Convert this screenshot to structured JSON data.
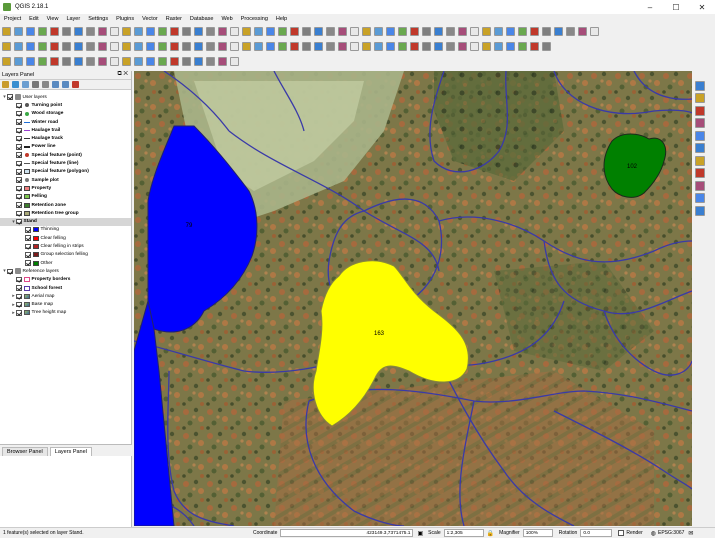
{
  "window": {
    "title": "QGIS 2.18.1",
    "controls": [
      "–",
      "☐",
      "✕"
    ]
  },
  "menu": [
    "Project",
    "Edit",
    "View",
    "Layer",
    "Settings",
    "Plugins",
    "Vector",
    "Raster",
    "Database",
    "Web",
    "Processing",
    "Help"
  ],
  "layers_panel": {
    "title": "Layers Panel",
    "tree": [
      {
        "label": "User layers",
        "level": 0,
        "bold": false,
        "expanded": true,
        "group": true
      },
      {
        "label": "Turning point",
        "level": 1,
        "bold": true,
        "symbol": "#555555",
        "shape": "dot"
      },
      {
        "label": "Wood storage",
        "level": 1,
        "bold": true,
        "symbol": "#3aa845",
        "shape": "dot"
      },
      {
        "label": "Winter road",
        "level": 1,
        "bold": true,
        "symbol": "#1e6fd8",
        "shape": "dash"
      },
      {
        "label": "Haulage trail",
        "level": 1,
        "bold": true,
        "symbol": "#9a3fd0",
        "shape": "line"
      },
      {
        "label": "Haulage track",
        "level": 1,
        "bold": true,
        "symbol": "#333333",
        "shape": "dash"
      },
      {
        "label": "Power line",
        "level": 1,
        "bold": true,
        "symbol": "#222222",
        "shape": "line"
      },
      {
        "label": "Special feature (point)",
        "level": 1,
        "bold": true,
        "symbol": "#c0392b",
        "shape": "dot"
      },
      {
        "label": "Special feature (line)",
        "level": 1,
        "bold": true,
        "symbol": "#555555",
        "shape": "line"
      },
      {
        "label": "Special feature (polygon)",
        "level": 1,
        "bold": true,
        "symbol": "#cfe3f0",
        "shape": "box"
      },
      {
        "label": "Sample plot",
        "level": 1,
        "bold": true,
        "symbol": "#777777",
        "shape": "dot"
      },
      {
        "label": "Property",
        "level": 1,
        "bold": true,
        "symbol": "#f08080",
        "shape": "box"
      },
      {
        "label": "Felling",
        "level": 1,
        "bold": true,
        "symbol": "#7ec850",
        "shape": "box"
      },
      {
        "label": "Retention zone",
        "level": 1,
        "bold": true,
        "symbol": "#3c7d2e",
        "shape": "box"
      },
      {
        "label": "Retention tree group",
        "level": 1,
        "bold": true,
        "symbol": "#a8a878",
        "shape": "box"
      },
      {
        "label": "Stand",
        "level": 1,
        "bold": true,
        "symbol": "",
        "shape": "none",
        "expanded": true,
        "selected": true
      },
      {
        "label": "Thinning",
        "level": 2,
        "bold": false,
        "symbol": "#0000ff",
        "shape": "box"
      },
      {
        "label": "Clear felling",
        "level": 2,
        "bold": false,
        "symbol": "#ff0000",
        "shape": "box"
      },
      {
        "label": "Clear felling in strips",
        "level": 2,
        "bold": false,
        "symbol": "#b22222",
        "shape": "box"
      },
      {
        "label": "Group selection felling",
        "level": 2,
        "bold": false,
        "symbol": "#7a1a1a",
        "shape": "box"
      },
      {
        "label": "Other",
        "level": 2,
        "bold": false,
        "symbol": "#008000",
        "shape": "box"
      },
      {
        "label": "Reference layers",
        "level": 0,
        "bold": false,
        "expanded": true,
        "group": true
      },
      {
        "label": "Property borders",
        "level": 1,
        "bold": true,
        "symbol": "#ffffff",
        "shape": "outline-pink"
      },
      {
        "label": "School forest",
        "level": 1,
        "bold": true,
        "symbol": "#ffffff",
        "shape": "outline-purple"
      },
      {
        "label": "Aerial map",
        "level": 1,
        "bold": false,
        "symbol": "",
        "shape": "raster",
        "collapsed": true
      },
      {
        "label": "Base map",
        "level": 1,
        "bold": false,
        "symbol": "",
        "shape": "raster",
        "collapsed": true
      },
      {
        "label": "Tree height map",
        "level": 1,
        "bold": false,
        "symbol": "",
        "shape": "raster",
        "collapsed": true
      }
    ],
    "tabs": [
      "Browser Panel",
      "Layers Panel"
    ]
  },
  "map": {
    "labels": [
      "79",
      "163",
      "102"
    ],
    "colors": {
      "thinning": "#0000ff",
      "other": "#008000",
      "highlight": "#ffff00",
      "boundary": "#3a3aa8"
    }
  },
  "status": {
    "message": "1 feature(s) selected on layer Stand.",
    "coordinate_label": "Coordinate",
    "coordinate_value": "423149.3,7371475.1",
    "scale_label": "Scale",
    "scale_value": "1:2,305",
    "magnifier_label": "Magnifier",
    "magnifier_value": "100%",
    "rotation_label": "Rotation",
    "rotation_value": "0.0",
    "render_label": "Render",
    "crs": "EPSG:3067"
  }
}
